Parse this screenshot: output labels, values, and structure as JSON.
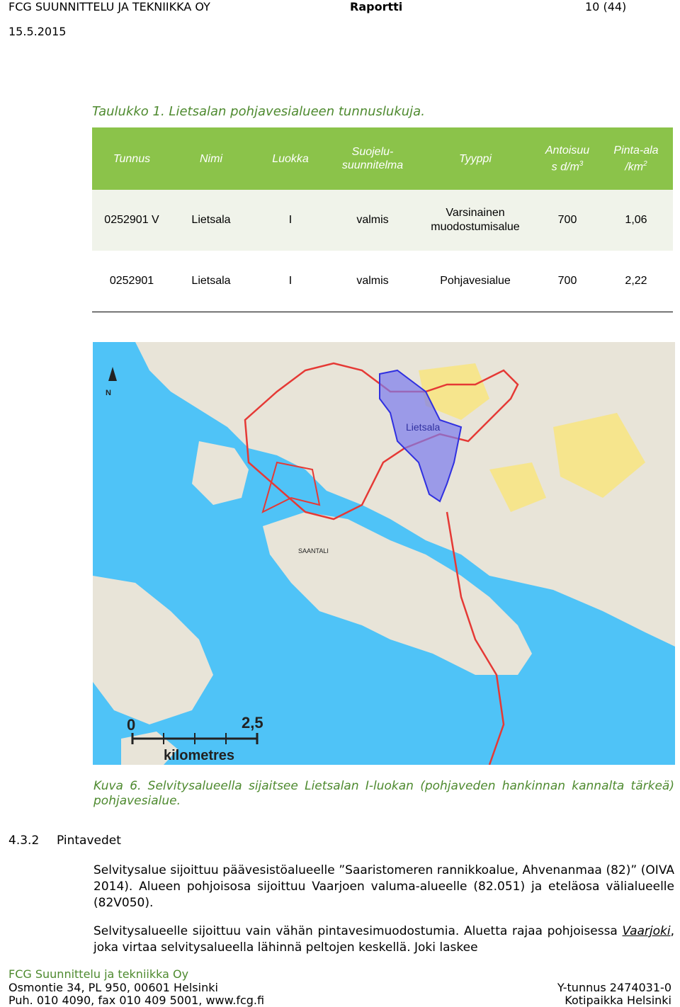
{
  "header": {
    "company": "FCG SUUNNITTELU JA TEKNIIKKA OY",
    "doc_type": "Raportti",
    "page": "10 (44)",
    "date": "15.5.2015"
  },
  "table": {
    "title": "Taulukko 1. Lietsalan pohjavesialueen tunnuslukuja.",
    "headers": [
      "Tunnus",
      "Nimi",
      "Luokka",
      "Suojelu-suunnitelma",
      "Tyyppi",
      "Antoisuus d/m3",
      "Pinta-ala /km2"
    ],
    "header_parts": {
      "suojelu_1": "Suojelu-",
      "suojelu_2": "suunnitelma",
      "antoisuus_1": "Antoisuu",
      "antoisuus_2": "s d/m",
      "antoisuus_sup": "3",
      "pinta_1": "Pinta-ala",
      "pinta_2": "/km",
      "pinta_sup": "2"
    },
    "rows": [
      {
        "tunnus": "0252901 V",
        "nimi": "Lietsala",
        "luokka": "I",
        "suojelu": "valmis",
        "tyyppi_1": "Varsinainen",
        "tyyppi_2": "muodostumisalue",
        "antoisuus": "700",
        "pinta_ala": "1,06"
      },
      {
        "tunnus": "0252901",
        "nimi": "Lietsala",
        "luokka": "I",
        "suojelu": "valmis",
        "tyyppi_1": "Pohjavesialue",
        "tyyppi_2": "",
        "antoisuus": "700",
        "pinta_ala": "2,22"
      }
    ],
    "colors": {
      "header_bg": "#8bc34a",
      "row1_bg": "#f0f3ea"
    }
  },
  "map": {
    "label_area": "Lietsala",
    "label_place": "SAANTALI",
    "scale_start": "0",
    "scale_end": "2,5",
    "scale_unit": "kilometres",
    "north_label": "N",
    "colors": {
      "water": "#4fc3f7",
      "land": "#e8e4d8",
      "forest": "#f6e58d",
      "boundary": "#e53935",
      "aquifer": "#3030e0"
    }
  },
  "caption": "Kuva 6. Selvitysalueella sijaitsee Lietsalan I-luokan (pohjaveden hankinnan kannalta tärkeä) pohjavesialue.",
  "section": {
    "number": "4.3.2",
    "title": "Pintavedet"
  },
  "paragraphs": {
    "p1": "Selvitysalue sijoittuu päävesistöalueelle ”Saaristomeren rannikkoalue, Ahvenanmaa (82)” (OIVA 2014). Alueen pohjoisosa sijoittuu Vaarjoen valuma-alueelle (82.051) ja eteläosa välialueelle (82V050).",
    "p2_start": "Selvitysalueelle sijoittuu vain vähän pintavesimuodostumia. Aluetta rajaa pohjoisessa ",
    "p2_em": "Vaarjoki",
    "p2_end": ", joka virtaa selvitysalueella lähinnä peltojen keskellä. Joki laskee"
  },
  "footer": {
    "company": "FCG Suunnittelu ja tekniikka Oy",
    "address": "Osmontie 34, PL 950, 00601 Helsinki",
    "phone": "Puh. 010 4090, fax 010 409 5001, www.fcg.fi",
    "ytunnus": "Y-tunnus 2474031-0",
    "kotipaikka": "Kotipaikka Helsinki"
  }
}
